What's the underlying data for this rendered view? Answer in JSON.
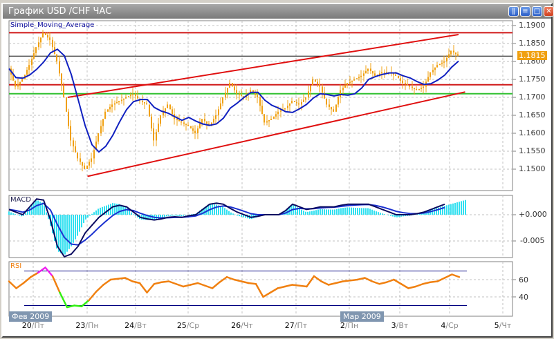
{
  "window": {
    "title": "График USD /CHF  ЧАС",
    "buttons": [
      "tile",
      "arrange",
      "maximize",
      "close"
    ]
  },
  "colors": {
    "candle": "#f0a010",
    "sma": "#1020c0",
    "hline_red": "#d01818",
    "hline_green": "#30c030",
    "trend": "#e01010",
    "macd_main": "#0a0a60",
    "macd_signal": "#1a30d0",
    "macd_hist": "#30e0f0",
    "rsi": "#f08010",
    "rsi_over": "#f020f0",
    "rsi_under": "#30f010",
    "level": "#000080"
  },
  "price_panel": {
    "title": "Simple_Moving_Average",
    "current_price": "1.1815",
    "axis_labels": [
      "1.1900",
      "1.1850",
      "1.1800",
      "1.1750",
      "1.1700",
      "1.1650",
      "1.1600",
      "1.1550",
      "1.1500"
    ]
  },
  "macd_panel": {
    "title": "MACD",
    "axis_labels": [
      "+0.000",
      "-0.005"
    ]
  },
  "rsi_panel": {
    "title": "RSI",
    "axis_labels": [
      "60",
      "40"
    ]
  },
  "months": [
    "Фев 2009",
    "Мар 2009"
  ],
  "dates": [
    {
      "d": "20",
      "w": "/Пт"
    },
    {
      "d": "23",
      "w": "/Пн"
    },
    {
      "d": "24",
      "w": "/Вт"
    },
    {
      "d": "25",
      "w": "/Ср"
    },
    {
      "d": "26",
      "w": "/Чт"
    },
    {
      "d": "27",
      "w": "/Пт"
    },
    {
      "d": "2",
      "w": "/Пн"
    },
    {
      "d": "3",
      "w": "/Вт"
    },
    {
      "d": "4",
      "w": "/Ср"
    },
    {
      "d": "5",
      "w": "/Чт"
    }
  ],
  "chart_data": [
    {
      "type": "line",
      "title": "USD/CHF H1 close (approx.)",
      "ylim": [
        1.148,
        1.192
      ],
      "values": [
        1.178,
        1.173,
        1.175,
        1.179,
        1.184,
        1.188,
        1.186,
        1.18,
        1.17,
        1.158,
        1.153,
        1.15,
        1.153,
        1.16,
        1.166,
        1.168,
        1.169,
        1.17,
        1.171,
        1.169,
        1.168,
        1.158,
        1.165,
        1.168,
        1.164,
        1.163,
        1.162,
        1.16,
        1.164,
        1.162,
        1.165,
        1.17,
        1.174,
        1.171,
        1.17,
        1.172,
        1.17,
        1.163,
        1.164,
        1.166,
        1.167,
        1.169,
        1.168,
        1.17,
        1.175,
        1.173,
        1.168,
        1.166,
        1.172,
        1.174,
        1.175,
        1.176,
        1.178,
        1.176,
        1.177,
        1.177,
        1.176,
        1.174,
        1.173,
        1.172,
        1.173,
        1.177,
        1.179,
        1.18,
        1.183,
        1.1815
      ],
      "hlines": [
        1.188,
        1.1815,
        1.1735,
        1.171
      ],
      "trendlines": [
        {
          "from": [
            1,
            1.17
          ],
          "to": [
            7,
            1.1875
          ]
        },
        {
          "from": [
            1.3,
            1.148
          ],
          "to": [
            7.1,
            1.1715
          ]
        }
      ]
    },
    {
      "type": "line",
      "title": "MACD",
      "ylim": [
        -0.009,
        0.004
      ],
      "main": [
        0.001,
        0.0005,
        0.0,
        0.0015,
        0.003,
        0.0028,
        -0.001,
        -0.006,
        -0.008,
        -0.0075,
        -0.006,
        -0.0035,
        -0.002,
        -0.0005,
        0.0005,
        0.0015,
        0.0018,
        0.0015,
        0.0005,
        -0.0005,
        -0.0008,
        -0.001,
        -0.0008,
        -0.0005,
        -0.0004,
        -0.0005,
        -0.0002,
        0.0,
        0.001,
        0.002,
        0.0022,
        0.002,
        0.0012,
        0.0005,
        0.0,
        -0.0005,
        -0.0003,
        0.0,
        0.0,
        0.0,
        0.0008,
        0.002,
        0.0015,
        0.001,
        0.0012,
        0.0015,
        0.0015,
        0.0015,
        0.0018,
        0.002,
        0.002,
        0.002,
        0.002,
        0.0015,
        0.001,
        0.0005,
        0.0,
        0.0,
        0.0,
        0.0002,
        0.0005,
        0.001,
        0.0015,
        0.002
      ]
    },
    {
      "type": "line",
      "title": "RSI",
      "ylim": [
        20,
        80
      ],
      "levels": [
        70,
        30
      ],
      "values": [
        58,
        50,
        56,
        63,
        68,
        74,
        64,
        45,
        28,
        30,
        29,
        36,
        46,
        54,
        60,
        61,
        62,
        58,
        56,
        45,
        55,
        57,
        58,
        55,
        52,
        54,
        56,
        53,
        50,
        57,
        63,
        60,
        58,
        56,
        55,
        40,
        45,
        50,
        52,
        54,
        53,
        52,
        64,
        58,
        54,
        56,
        58,
        59,
        60,
        62,
        58,
        55,
        57,
        60,
        55,
        50,
        52,
        55,
        57,
        58,
        62,
        66,
        63
      ]
    }
  ]
}
